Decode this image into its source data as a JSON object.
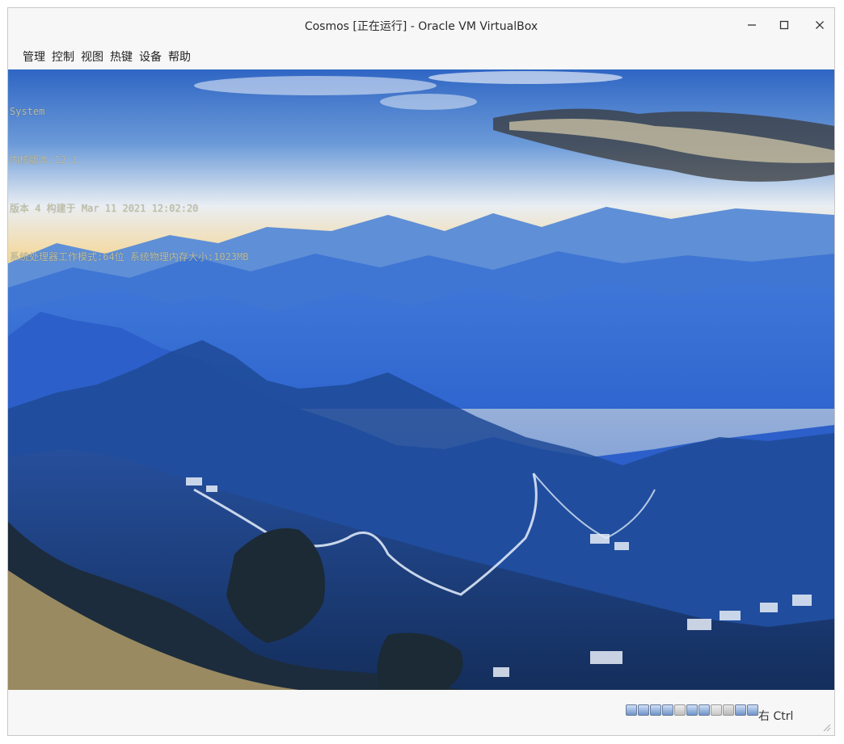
{
  "window": {
    "title": "Cosmos [正在运行] - Oracle VM VirtualBox",
    "controls": [
      "minimize-icon",
      "maximize-icon",
      "close-icon"
    ]
  },
  "menubar": {
    "items": [
      {
        "label": "管理"
      },
      {
        "label": "控制"
      },
      {
        "label": "视图"
      },
      {
        "label": "热键"
      },
      {
        "label": "设备"
      },
      {
        "label": "帮助"
      }
    ]
  },
  "guest_console": {
    "lines": [
      "System",
      "内核版本:12.1",
      "版本 4 构建于 Mar 11 2021 12:02:20",
      "系统处理器工作模式:64位 系统物理内存大小:1023MB"
    ],
    "text_color": "#bfbfa0"
  },
  "statusbar": {
    "icons": [
      "hard-disk-icon",
      "optical-drive-icon",
      "audio-icon",
      "network-icon",
      "usb-icon",
      "shared-folders-icon",
      "display-icon",
      "video-capture-icon",
      "cpu-icon",
      "mouse-integration-icon",
      "keyboard-icon"
    ],
    "host_key_label": "右 Ctrl"
  },
  "colors": {
    "window_bg": "#f6f7f6",
    "sky_top": "#2f66c4",
    "horizon": "#f4d9a0",
    "mountain_blue": "#2c5fc9",
    "mountain_dark": "#1d3f7a"
  }
}
